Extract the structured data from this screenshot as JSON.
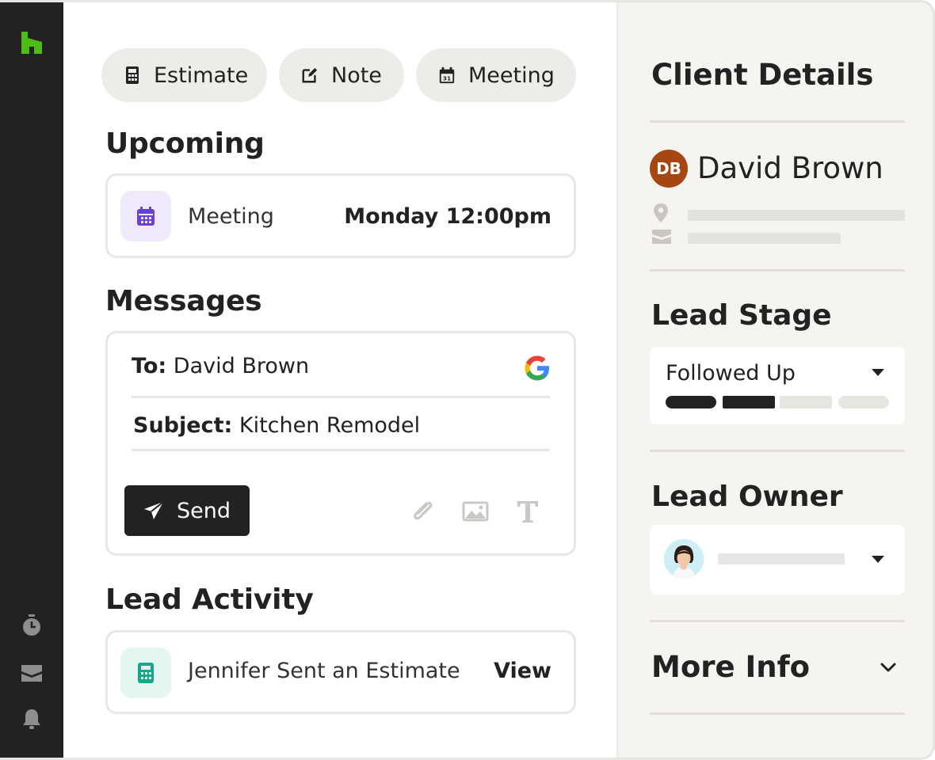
{
  "actions": {
    "estimate_label": "Estimate",
    "note_label": "Note",
    "meeting_label": "Meeting"
  },
  "upcoming": {
    "title": "Upcoming",
    "item_label": "Meeting",
    "item_time": "Monday 12:00pm"
  },
  "messages": {
    "title": "Messages",
    "to_label": "To:",
    "to_value": "David Brown",
    "subject_label": "Subject:",
    "subject_value": "Kitchen Remodel",
    "send_label": "Send"
  },
  "activity": {
    "title": "Lead Activity",
    "item_label": "Jennifer Sent an Estimate",
    "view_label": "View"
  },
  "client": {
    "title": "Client Details",
    "initials": "DB",
    "name": "David Brown"
  },
  "lead_stage": {
    "title": "Lead Stage",
    "value": "Followed Up",
    "steps_completed": 2,
    "steps_total": 4
  },
  "lead_owner": {
    "title": "Lead Owner"
  },
  "more_info": {
    "title": "More Info"
  },
  "colors": {
    "brand_green": "#4dbc15",
    "rail": "#222222",
    "calendar_purple": "#6a3fd6",
    "estimate_teal": "#18a58a",
    "avatar_brown": "#a64611"
  },
  "icons": {
    "rail": [
      "houzz-logo-icon",
      "stopwatch-icon",
      "inbox-icon",
      "bell-icon"
    ],
    "tools": [
      "attachment-icon",
      "image-icon",
      "text-format-icon"
    ]
  }
}
